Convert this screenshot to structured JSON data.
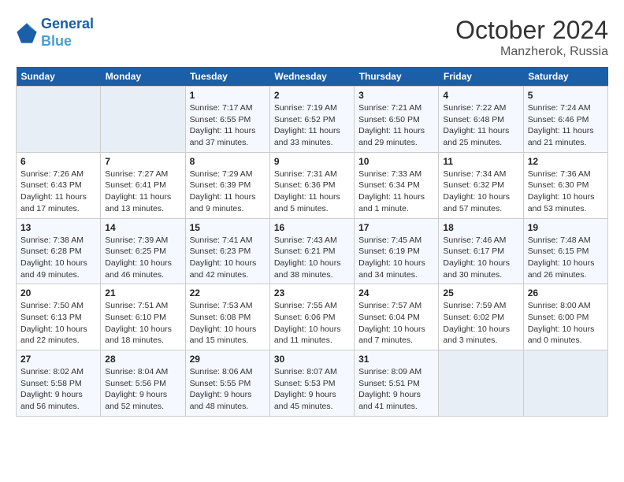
{
  "header": {
    "logo_line1": "General",
    "logo_line2": "Blue",
    "month_year": "October 2024",
    "location": "Manzherok, Russia"
  },
  "weekdays": [
    "Sunday",
    "Monday",
    "Tuesday",
    "Wednesday",
    "Thursday",
    "Friday",
    "Saturday"
  ],
  "weeks": [
    [
      {
        "day": "",
        "detail": ""
      },
      {
        "day": "",
        "detail": ""
      },
      {
        "day": "1",
        "detail": "Sunrise: 7:17 AM\nSunset: 6:55 PM\nDaylight: 11 hours and 37 minutes."
      },
      {
        "day": "2",
        "detail": "Sunrise: 7:19 AM\nSunset: 6:52 PM\nDaylight: 11 hours and 33 minutes."
      },
      {
        "day": "3",
        "detail": "Sunrise: 7:21 AM\nSunset: 6:50 PM\nDaylight: 11 hours and 29 minutes."
      },
      {
        "day": "4",
        "detail": "Sunrise: 7:22 AM\nSunset: 6:48 PM\nDaylight: 11 hours and 25 minutes."
      },
      {
        "day": "5",
        "detail": "Sunrise: 7:24 AM\nSunset: 6:46 PM\nDaylight: 11 hours and 21 minutes."
      }
    ],
    [
      {
        "day": "6",
        "detail": "Sunrise: 7:26 AM\nSunset: 6:43 PM\nDaylight: 11 hours and 17 minutes."
      },
      {
        "day": "7",
        "detail": "Sunrise: 7:27 AM\nSunset: 6:41 PM\nDaylight: 11 hours and 13 minutes."
      },
      {
        "day": "8",
        "detail": "Sunrise: 7:29 AM\nSunset: 6:39 PM\nDaylight: 11 hours and 9 minutes."
      },
      {
        "day": "9",
        "detail": "Sunrise: 7:31 AM\nSunset: 6:36 PM\nDaylight: 11 hours and 5 minutes."
      },
      {
        "day": "10",
        "detail": "Sunrise: 7:33 AM\nSunset: 6:34 PM\nDaylight: 11 hours and 1 minute."
      },
      {
        "day": "11",
        "detail": "Sunrise: 7:34 AM\nSunset: 6:32 PM\nDaylight: 10 hours and 57 minutes."
      },
      {
        "day": "12",
        "detail": "Sunrise: 7:36 AM\nSunset: 6:30 PM\nDaylight: 10 hours and 53 minutes."
      }
    ],
    [
      {
        "day": "13",
        "detail": "Sunrise: 7:38 AM\nSunset: 6:28 PM\nDaylight: 10 hours and 49 minutes."
      },
      {
        "day": "14",
        "detail": "Sunrise: 7:39 AM\nSunset: 6:25 PM\nDaylight: 10 hours and 46 minutes."
      },
      {
        "day": "15",
        "detail": "Sunrise: 7:41 AM\nSunset: 6:23 PM\nDaylight: 10 hours and 42 minutes."
      },
      {
        "day": "16",
        "detail": "Sunrise: 7:43 AM\nSunset: 6:21 PM\nDaylight: 10 hours and 38 minutes."
      },
      {
        "day": "17",
        "detail": "Sunrise: 7:45 AM\nSunset: 6:19 PM\nDaylight: 10 hours and 34 minutes."
      },
      {
        "day": "18",
        "detail": "Sunrise: 7:46 AM\nSunset: 6:17 PM\nDaylight: 10 hours and 30 minutes."
      },
      {
        "day": "19",
        "detail": "Sunrise: 7:48 AM\nSunset: 6:15 PM\nDaylight: 10 hours and 26 minutes."
      }
    ],
    [
      {
        "day": "20",
        "detail": "Sunrise: 7:50 AM\nSunset: 6:13 PM\nDaylight: 10 hours and 22 minutes."
      },
      {
        "day": "21",
        "detail": "Sunrise: 7:51 AM\nSunset: 6:10 PM\nDaylight: 10 hours and 18 minutes."
      },
      {
        "day": "22",
        "detail": "Sunrise: 7:53 AM\nSunset: 6:08 PM\nDaylight: 10 hours and 15 minutes."
      },
      {
        "day": "23",
        "detail": "Sunrise: 7:55 AM\nSunset: 6:06 PM\nDaylight: 10 hours and 11 minutes."
      },
      {
        "day": "24",
        "detail": "Sunrise: 7:57 AM\nSunset: 6:04 PM\nDaylight: 10 hours and 7 minutes."
      },
      {
        "day": "25",
        "detail": "Sunrise: 7:59 AM\nSunset: 6:02 PM\nDaylight: 10 hours and 3 minutes."
      },
      {
        "day": "26",
        "detail": "Sunrise: 8:00 AM\nSunset: 6:00 PM\nDaylight: 10 hours and 0 minutes."
      }
    ],
    [
      {
        "day": "27",
        "detail": "Sunrise: 8:02 AM\nSunset: 5:58 PM\nDaylight: 9 hours and 56 minutes."
      },
      {
        "day": "28",
        "detail": "Sunrise: 8:04 AM\nSunset: 5:56 PM\nDaylight: 9 hours and 52 minutes."
      },
      {
        "day": "29",
        "detail": "Sunrise: 8:06 AM\nSunset: 5:55 PM\nDaylight: 9 hours and 48 minutes."
      },
      {
        "day": "30",
        "detail": "Sunrise: 8:07 AM\nSunset: 5:53 PM\nDaylight: 9 hours and 45 minutes."
      },
      {
        "day": "31",
        "detail": "Sunrise: 8:09 AM\nSunset: 5:51 PM\nDaylight: 9 hours and 41 minutes."
      },
      {
        "day": "",
        "detail": ""
      },
      {
        "day": "",
        "detail": ""
      }
    ]
  ]
}
